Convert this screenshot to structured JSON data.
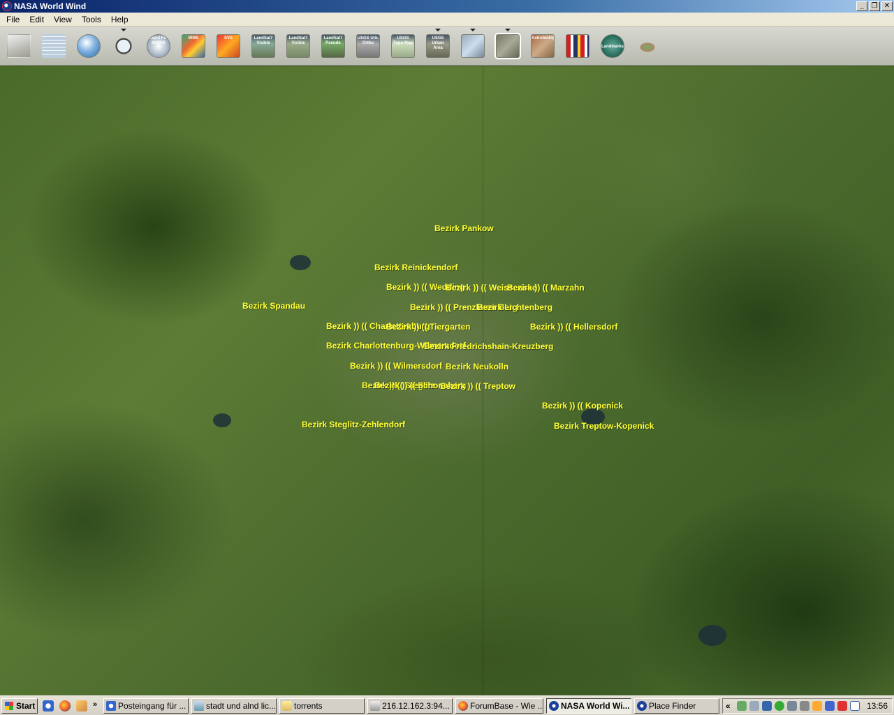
{
  "window": {
    "title": "NASA World Wind",
    "buttons": [
      "_",
      "❐",
      "✕"
    ]
  },
  "menu": [
    "File",
    "Edit",
    "View",
    "Tools",
    "Help"
  ],
  "toolbar": {
    "tools": [
      {
        "name": "layers-tool-icon",
        "label": ""
      },
      {
        "name": "latlon-grid-tool-icon",
        "label": ""
      },
      {
        "name": "globe-tool-icon",
        "label": ""
      },
      {
        "name": "search-tool-icon",
        "label": ""
      },
      {
        "name": "modis-tool-icon",
        "label": "Rapid Fire MODIS"
      },
      {
        "name": "wms-tool-icon",
        "label": "WMS"
      },
      {
        "name": "svs-tool-icon",
        "label": "SVS"
      },
      {
        "name": "landsat-visible-tool-icon",
        "label": "LandSat7 Visible"
      },
      {
        "name": "landsat-visible2-tool-icon",
        "label": "LandSat7 Visible"
      },
      {
        "name": "landsat-pseudo-tool-icon",
        "label": "LandSat7 Pseudo"
      },
      {
        "name": "usgs-urban-tool-icon",
        "label": "USGS Urb. Ortho"
      },
      {
        "name": "usgs-topo-tool-icon",
        "label": "USGS Topo Map"
      },
      {
        "name": "usgs-urban2-tool-icon",
        "label": "USGS Urban Area"
      },
      {
        "name": "satellite-tool-icon",
        "label": ""
      },
      {
        "name": "placenames-tool-icon",
        "label": ""
      },
      {
        "name": "astrobiology-tool-icon",
        "label": "Astrobiology"
      },
      {
        "name": "flags-tool-icon",
        "label": ""
      },
      {
        "name": "landmarks-tool-icon",
        "label": "Landmarks"
      },
      {
        "name": "us-map-tool-icon",
        "label": ""
      }
    ]
  },
  "places": [
    "Bezirk Pankow",
    "Bezirk Reinickendorf",
    "Bezirk )) (( Wedding",
    "Bezirk )) (( Weissensee",
    "Bezirk )) (( Marzahn",
    "Bezirk Spandau",
    "Bezirk )) (( Prenzlauer Berg",
    "Bezirk Lichtenberg",
    "Bezirk )) (( Charlottenburg",
    "Bezirk )) (( Tiergarten",
    "Bezirk )) (( Hellersdorf",
    "Bezirk Charlottenburg-Wilmersdorf",
    "Bezirk Friedrichshain-Kreuzberg",
    "Bezirk )) (( Wilmersdorf",
    "Bezirk Neukolln",
    "Bezirk )) (( Steglitz",
    "Bezirk )) (( Schoneberg",
    "Bezirk )) (( Treptow",
    "Bezirk )) (( Kopenick",
    "Bezirk Steglitz-Zehlendorf",
    "Bezirk Treptow-Kopenick"
  ],
  "taskbar": {
    "start": "Start",
    "tasks": [
      "Posteingang für ...",
      "stadt und alnd lic...",
      "torrents",
      "216.12.162.3:94...",
      "ForumBase - Wie ...",
      "NASA World Wi...",
      "Place Finder"
    ],
    "tray_chevron": "«",
    "clock": "13:56"
  }
}
